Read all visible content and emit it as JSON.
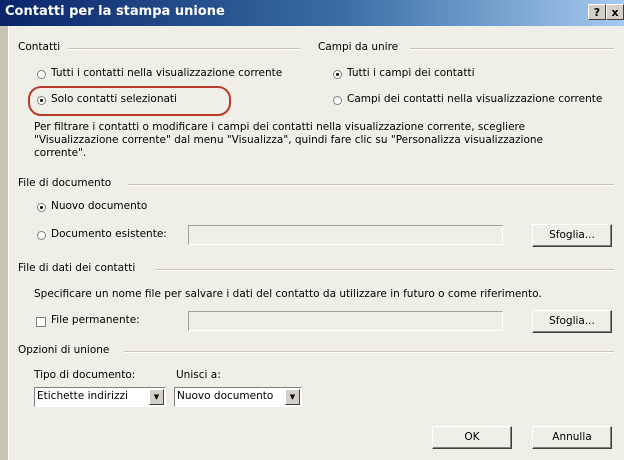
{
  "window": {
    "title": "Contatti per la stampa unione",
    "help_button": "?",
    "close_button": "x"
  },
  "contacts_group": {
    "title": "Contatti",
    "option_all": "Tutti i contatti nella visualizzazione corrente",
    "option_selected": "Solo contatti selezionati",
    "selected": "Solo contatti selezionati"
  },
  "fields_group": {
    "title": "Campi da unire",
    "option_all": "Tutti i campi dei contatti",
    "option_view": "Campi dei contatti nella visualizzazione corrente",
    "selected": "Tutti i campi dei contatti"
  },
  "info_text": {
    "line1": "Per filtrare i contatti o modificare i campi dei contatti nella visualizzazione corrente, scegliere",
    "line2": "\"Visualizzazione corrente\" dal menu \"Visualizza\", quindi fare clic su \"Personalizza visualizzazione",
    "line3": "corrente\"."
  },
  "document_group": {
    "title": "File di documento",
    "option_new": "Nuovo documento",
    "option_existing": "Documento esistente:",
    "selected": "Nuovo documento",
    "existing_path": "",
    "browse_label": "Sfoglia..."
  },
  "data_file_group": {
    "title": "File di dati dei contatti",
    "description": "Specificare un nome file per salvare i dati del contatto da utilizzare in futuro o come riferimento.",
    "permanent_label": "File permanente:",
    "permanent_checked": false,
    "permanent_path": "",
    "browse_label": "Sfoglia..."
  },
  "merge_options_group": {
    "title": "Opzioni di unione",
    "doc_type_label": "Tipo di documento:",
    "doc_type_value": "Etichette indirizzi",
    "merge_to_label": "Unisci a:",
    "merge_to_value": "Nuovo documento"
  },
  "buttons": {
    "ok": "OK",
    "cancel": "Annulla"
  },
  "colors": {
    "title_start": "#0a246a",
    "title_end": "#a6caf0",
    "dialog_bg": "#f0efe7",
    "highlight": "#b83a2b"
  }
}
